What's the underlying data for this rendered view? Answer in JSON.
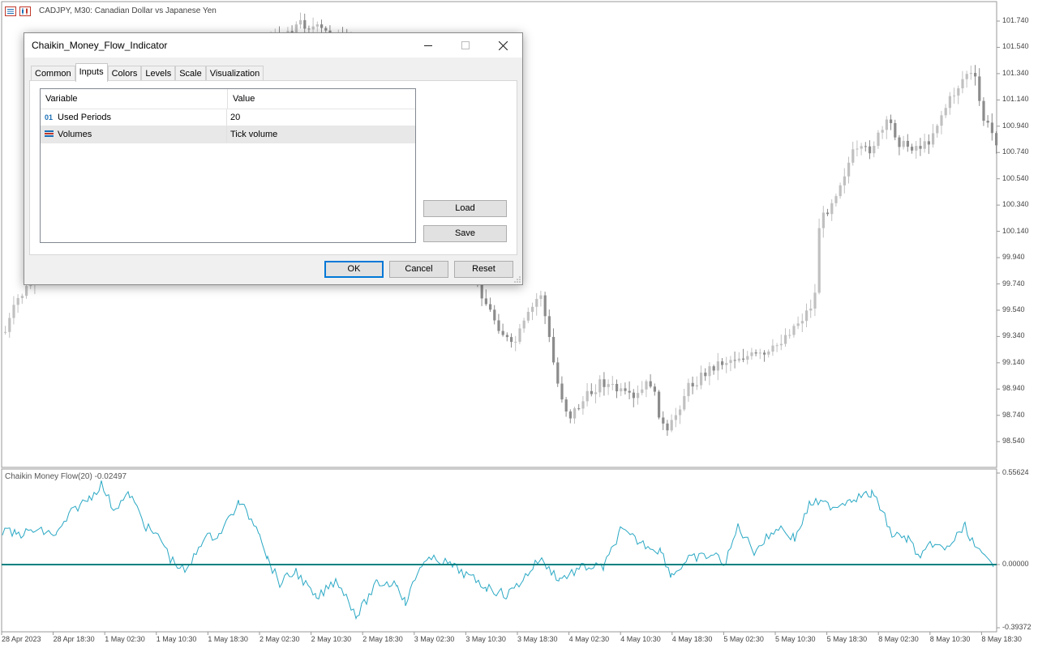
{
  "chart": {
    "title": "CADJPY, M30:  Canadian Dollar vs Japanese Yen",
    "price_labels": [
      "101.740",
      "101.540",
      "101.340",
      "101.140",
      "100.940",
      "100.740",
      "100.540",
      "100.340",
      "100.140",
      "99.940",
      "99.740",
      "99.540",
      "99.340",
      "99.140",
      "98.940",
      "98.740",
      "98.540"
    ],
    "indicator_label": "Chaikin Money Flow(20) -0.02497",
    "indicator_levels": [
      "0.55624",
      "0.00000",
      "-0.39372"
    ],
    "time_labels": [
      "28 Apr 2023",
      "28 Apr 18:30",
      "1 May 02:30",
      "1 May 10:30",
      "1 May 18:30",
      "2 May 02:30",
      "2 May 10:30",
      "2 May 18:30",
      "3 May 02:30",
      "3 May 10:30",
      "3 May 18:30",
      "4 May 02:30",
      "4 May 10:30",
      "4 May 18:30",
      "5 May 02:30",
      "5 May 10:30",
      "5 May 18:30",
      "8 May 02:30",
      "8 May 10:30",
      "8 May 18:30"
    ],
    "colors": {
      "candle": "#8c8c8c",
      "candle_bull": "#c0c0c0",
      "indicator_line": "#2aa8c4",
      "zero_line": "#008080"
    }
  },
  "dialog": {
    "title": "Chaikin_Money_Flow_Indicator",
    "window_buttons": {
      "minimize": "minimize-icon",
      "maximize": "maximize-icon",
      "close": "close-icon"
    },
    "tabs": [
      {
        "label": "Common",
        "active": false
      },
      {
        "label": "Inputs",
        "active": true
      },
      {
        "label": "Colors",
        "active": false
      },
      {
        "label": "Levels",
        "active": false
      },
      {
        "label": "Scale",
        "active": false
      },
      {
        "label": "Visualization",
        "active": false
      }
    ],
    "grid": {
      "headers": [
        "Variable",
        "Value"
      ],
      "rows": [
        {
          "icon": "integer-icon",
          "icon_text": "01",
          "variable": "Used Periods",
          "value": "20",
          "selected": false
        },
        {
          "icon": "enum-list-icon",
          "icon_text": "",
          "variable": "Volumes",
          "value": "Tick volume",
          "selected": true
        }
      ]
    },
    "side_buttons": {
      "load": "Load",
      "save": "Save"
    },
    "footer": {
      "ok": "OK",
      "cancel": "Cancel",
      "reset": "Reset"
    }
  }
}
